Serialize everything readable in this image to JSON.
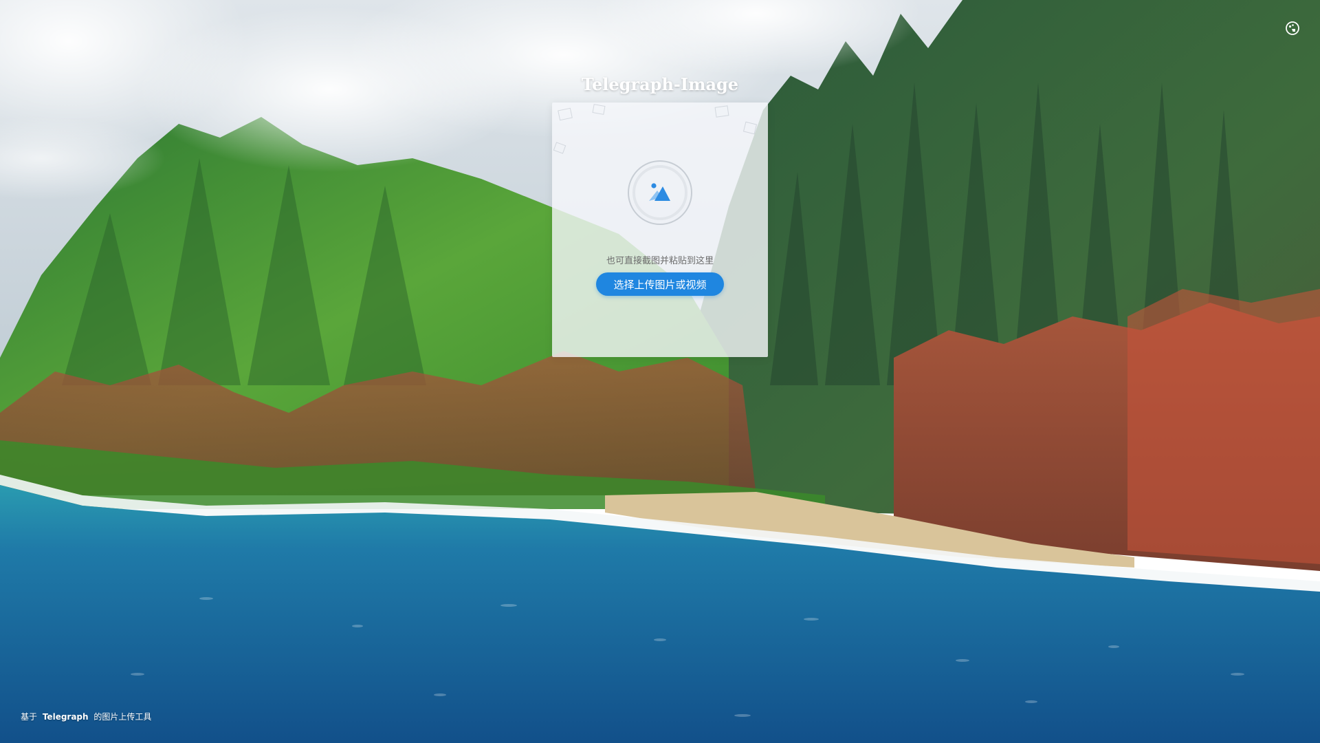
{
  "header": {
    "title": "Telegraph-Image",
    "theme_icon": "palette-icon"
  },
  "upload": {
    "icon": "image-upload-icon",
    "hint": "也可直接截图并粘贴到这里",
    "button_label": "选择上传图片或视频"
  },
  "footer": {
    "prefix": "基于",
    "brand": "Telegraph",
    "suffix": "的图片上传工具"
  },
  "colors": {
    "accent": "#1f86e0",
    "card_background": "#f6f8fb",
    "sea": "#1a6aa0",
    "mountains": "#3f8f2a",
    "cliffs": "#b5553a"
  }
}
